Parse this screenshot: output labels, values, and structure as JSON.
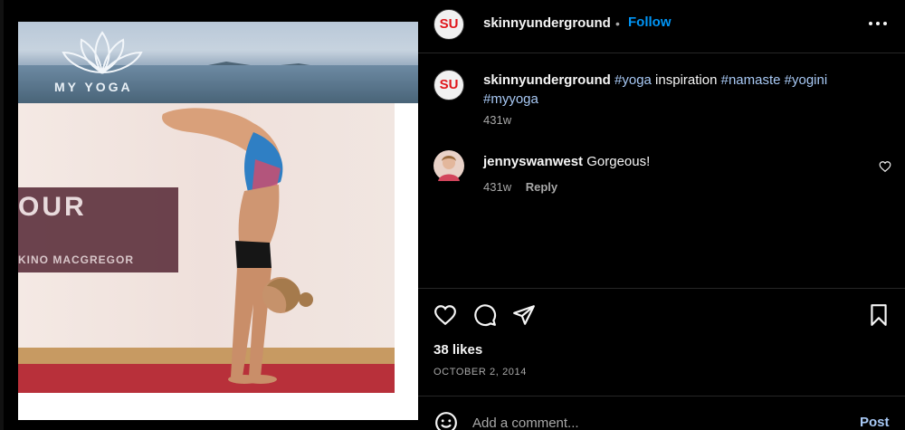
{
  "photo": {
    "logo_text": "MY YOGA",
    "overlay_title": "OUR",
    "overlay_subtitle": "KINO MACGREGOR"
  },
  "header": {
    "avatar_initials": "SU",
    "username": "skinnyunderground",
    "separator": "•",
    "follow_label": "Follow",
    "more_icon": "more-horizontal-icon"
  },
  "caption": {
    "avatar_initials": "SU",
    "username": "skinnyunderground",
    "tokens": [
      {
        "text": "#yoga",
        "hashtag": true
      },
      {
        "text": " inspiration ",
        "hashtag": false
      },
      {
        "text": "#namaste",
        "hashtag": true
      },
      {
        "text": " ",
        "hashtag": false
      },
      {
        "text": "#yogini",
        "hashtag": true
      },
      {
        "text": " ",
        "hashtag": false
      },
      {
        "text": "#myyoga",
        "hashtag": true
      }
    ],
    "time": "431w"
  },
  "comments": [
    {
      "username": "jennyswanwest",
      "text": "Gorgeous!",
      "time": "431w",
      "reply_label": "Reply"
    }
  ],
  "actions": {
    "likes": "38 likes",
    "date": "OCTOBER 2, 2014"
  },
  "composer": {
    "placeholder": "Add a comment...",
    "post_label": "Post"
  },
  "colors": {
    "background": "#000000",
    "accent": "#0095f6",
    "hashtag": "#a8c9f5",
    "secondary_text": "#a8a8a8"
  }
}
